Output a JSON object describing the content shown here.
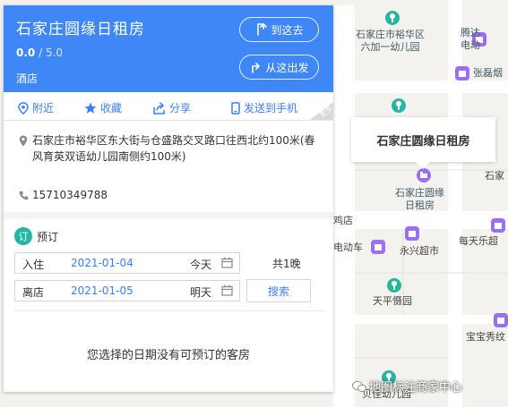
{
  "colors": {
    "header_blue": "#3f86f7",
    "link_blue": "#3d7ff2",
    "teal_pin": "#27b5a3",
    "purple_pin": "#9b6ff0"
  },
  "place": {
    "name": "石家庄圆缘日租房",
    "rating": "0.0",
    "rating_max": "/ 5.0",
    "category": "酒店",
    "address": "石家庄市裕华区东大街与仓盛路交叉路口往西北约100米(春风育英双语幼儿园南侧约100米)",
    "phone": "15710349788"
  },
  "route": {
    "to_label": "到这去",
    "from_label": "从这出发"
  },
  "actions": {
    "nearby": "附近",
    "favorite": "收藏",
    "share": "分享",
    "send_phone": "发送到手机",
    "more": "更多"
  },
  "booking": {
    "badge": "订",
    "title": "预订",
    "checkin_label": "入住",
    "checkin_date": "2021-01-04",
    "checkin_day": "今天",
    "checkout_label": "离店",
    "checkout_date": "2021-01-05",
    "checkout_day": "明天",
    "nights": "共1晚",
    "search": "搜索",
    "no_rooms": "您选择的日期没有可预订的客房"
  },
  "map": {
    "tooltip": "石家庄圆缘日租房",
    "pois": {
      "kindergarten_top": "石家庄市裕华区\n六加一幼儿园",
      "teng_top": "腾达\n电动",
      "zhangxin": "张磊烟",
      "selected_poi": "石家庄圆缘\n日租房",
      "stone_right": "石家",
      "chicken": "鸡店",
      "ebike": "电动车",
      "yongxing": "永兴超市",
      "meitian": "每天乐超",
      "tianping": "天平慑园",
      "baobao": "宝宝秀纹",
      "beijia": "贝佳幼儿园"
    },
    "watermark": "地图标注商家中心"
  }
}
